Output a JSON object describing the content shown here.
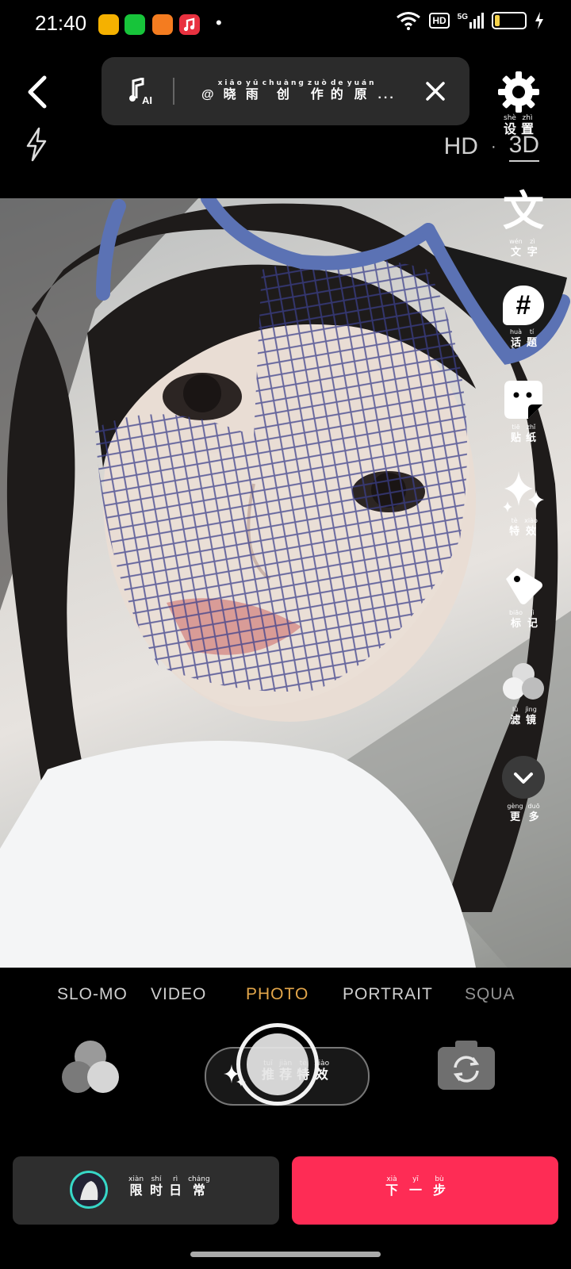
{
  "status": {
    "time": "21:40",
    "dot": "•",
    "hd": "HD",
    "network": "5G"
  },
  "music": {
    "title_prefix": "@",
    "title": [
      [
        "xiǎo",
        "晓"
      ],
      [
        "yǔ",
        "雨"
      ],
      [
        "chuàng",
        "创"
      ],
      [
        "zuò",
        "作"
      ],
      [
        "de",
        "的"
      ],
      [
        "yuán",
        "原"
      ]
    ],
    "ellipsis": "..."
  },
  "settings": {
    "label": [
      [
        "shè",
        "设"
      ],
      [
        "zhì",
        "置"
      ]
    ]
  },
  "quality": {
    "hd": "HD",
    "sep": "·",
    "three_d": "3D"
  },
  "tools": [
    {
      "id": "text",
      "glyph": "文",
      "label": [
        [
          "wén",
          "文"
        ],
        [
          "zì",
          "字"
        ]
      ]
    },
    {
      "id": "topic",
      "glyph": "#",
      "label": [
        [
          "huà",
          "话"
        ],
        [
          "tí",
          "题"
        ]
      ]
    },
    {
      "id": "sticker",
      "label": [
        [
          "tiē",
          "贴"
        ],
        [
          "zhǐ",
          "纸"
        ]
      ]
    },
    {
      "id": "effects",
      "label": [
        [
          "tè",
          "特"
        ],
        [
          "xiào",
          "效"
        ]
      ]
    },
    {
      "id": "tag",
      "label": [
        [
          "biāo",
          "标"
        ],
        [
          "jì",
          "记"
        ]
      ]
    },
    {
      "id": "filter",
      "label": [
        [
          "lǜ",
          "滤"
        ],
        [
          "jìng",
          "镜"
        ]
      ]
    },
    {
      "id": "more",
      "label": [
        [
          "gèng",
          "更"
        ],
        [
          "duō",
          "多"
        ]
      ]
    }
  ],
  "modes": [
    "SLO-MO",
    "VIDEO",
    "PHOTO",
    "PORTRAIT",
    "SQUA"
  ],
  "active_mode": "PHOTO",
  "recommend": {
    "label": [
      [
        "tuī",
        "推"
      ],
      [
        "jiàn",
        "荐"
      ],
      [
        "tè",
        "特"
      ],
      [
        "xiào",
        "效"
      ]
    ]
  },
  "daily": {
    "label": [
      [
        "xiàn",
        "限"
      ],
      [
        "shí",
        "时"
      ],
      [
        "rì",
        "日"
      ],
      [
        "cháng",
        "常"
      ]
    ]
  },
  "next": {
    "label": [
      [
        "xià",
        "下"
      ],
      [
        "yī",
        "一"
      ],
      [
        "bù",
        "步"
      ]
    ]
  },
  "colors": {
    "accent": "#fe2c55",
    "active_mode": "#e3a64a",
    "panel": "#2b2b2b"
  }
}
